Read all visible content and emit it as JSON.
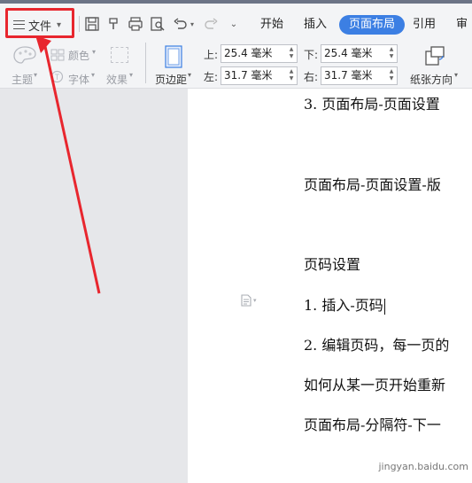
{
  "menu": {
    "file_label": "文件"
  },
  "tabs": [
    {
      "label": "开始"
    },
    {
      "label": "插入"
    },
    {
      "label": "页面布局"
    },
    {
      "label": "引用"
    },
    {
      "label": "审阅"
    }
  ],
  "ribbon": {
    "theme": "主题",
    "color": "颜色",
    "font": "字体",
    "effect": "效果",
    "margins": "页边距",
    "orientation": "纸张方向",
    "top_label": "上:",
    "top_value": "25.4 毫米",
    "bottom_label": "下:",
    "bottom_value": "25.4 毫米",
    "left_label": "左:",
    "left_value": "31.7 毫米",
    "right_label": "右:",
    "right_value": "31.7 毫米"
  },
  "document": {
    "lines": [
      "3. 页面布局-页面设置",
      "页面布局-页面设置-版",
      "页码设置",
      "1. 插入-页码",
      "2. 编辑页码，每一页的",
      "如何从某一页开始重新",
      "页面布局-分隔符-下一"
    ]
  },
  "watermark": "jingyan.baidu.com",
  "colors": {
    "accent": "#3c7fe3",
    "highlight": "#e8262e"
  }
}
